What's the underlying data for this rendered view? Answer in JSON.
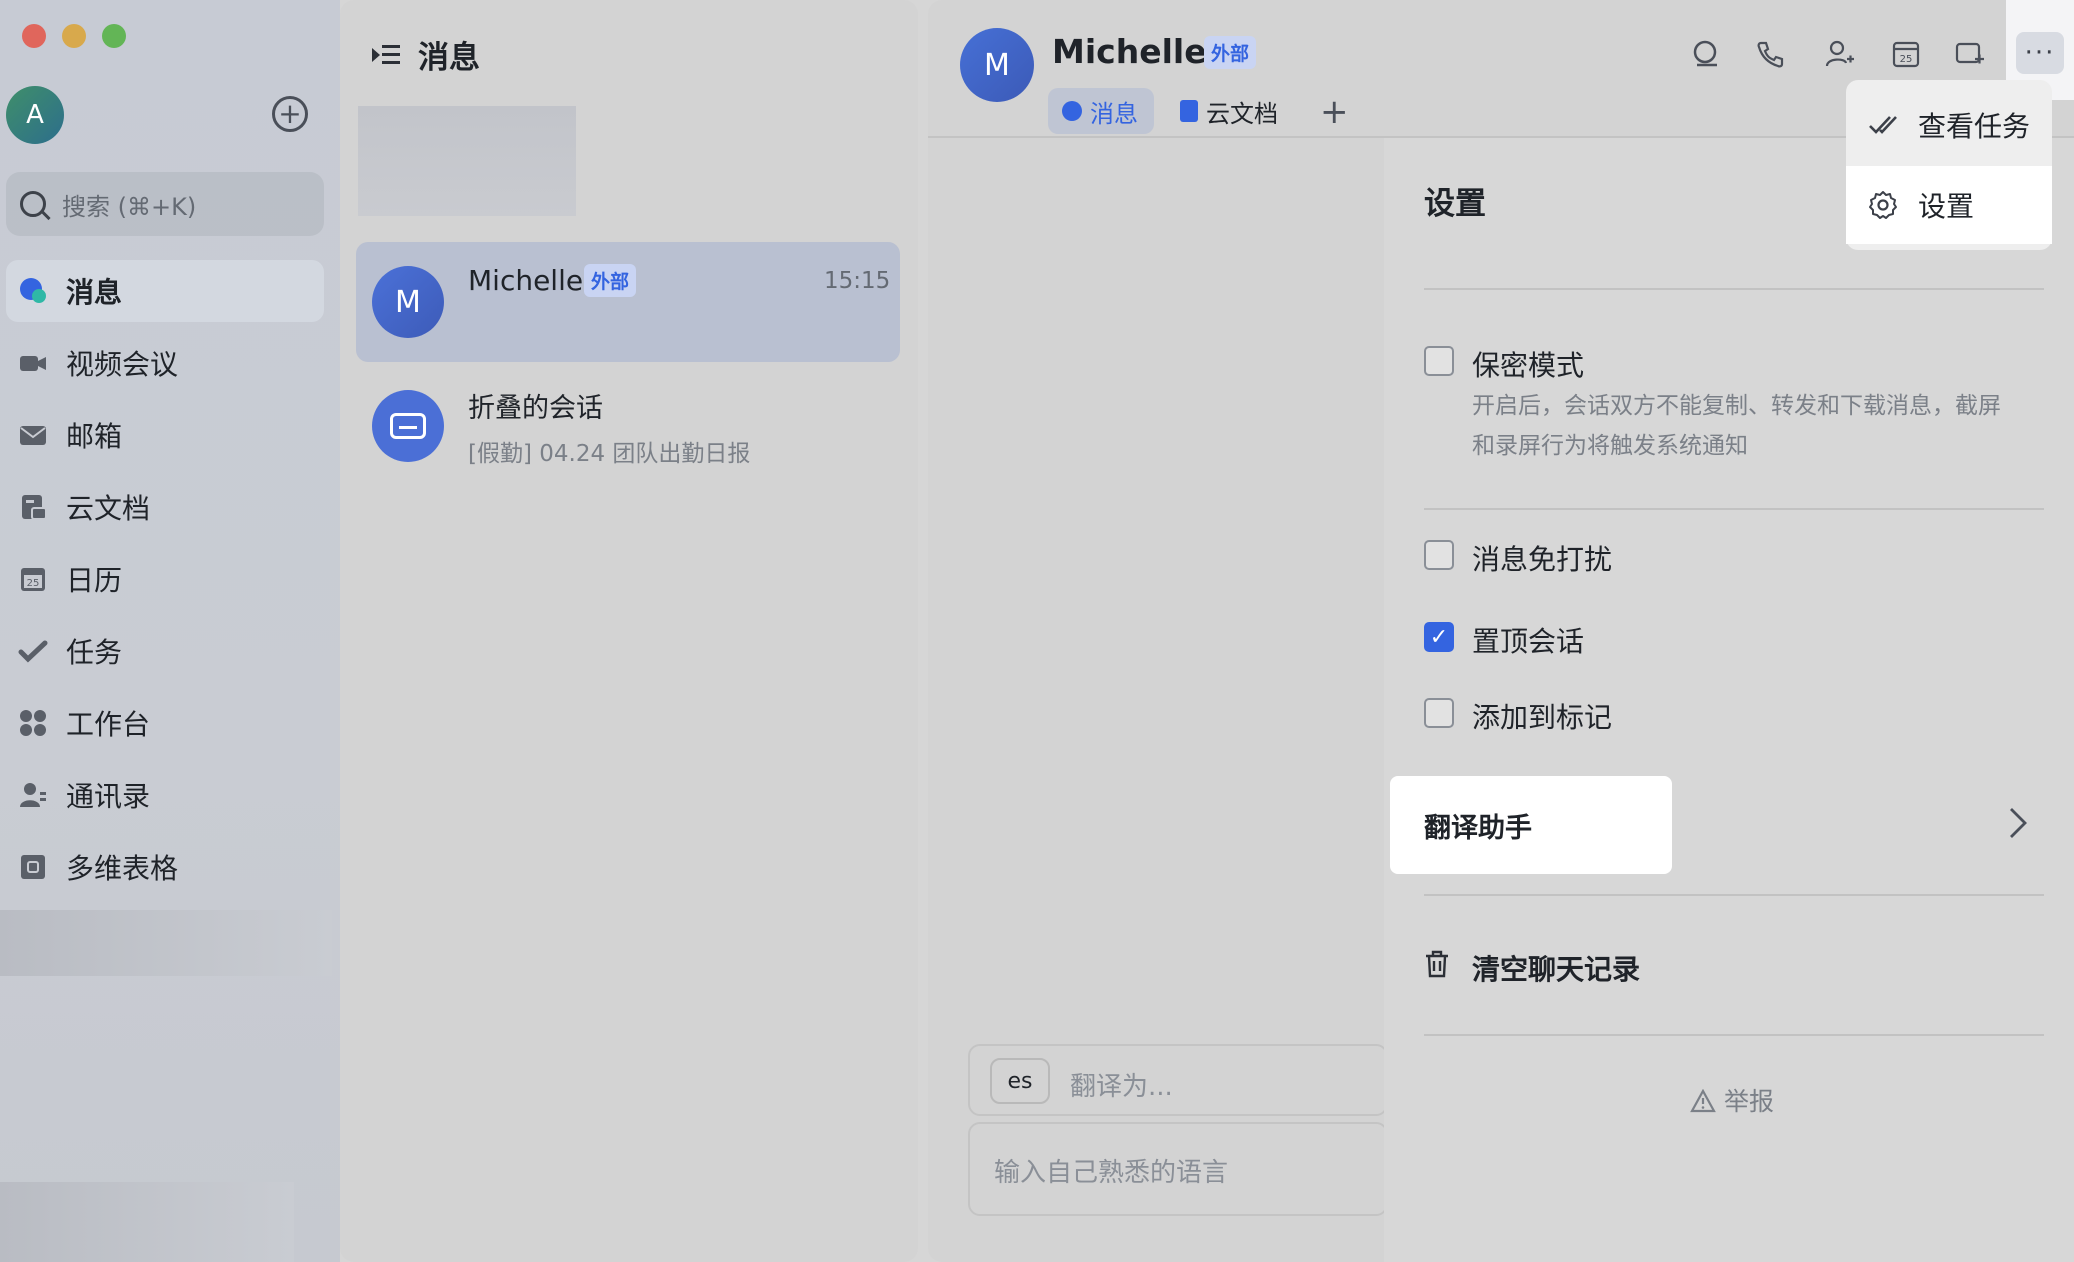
{
  "sidebar": {
    "avatar_letter": "A",
    "search_placeholder": "搜索 (⌘+K)",
    "items": [
      {
        "label": "消息",
        "icon": "chat-bubble-icon"
      },
      {
        "label": "视频会议",
        "icon": "video-camera-icon"
      },
      {
        "label": "邮箱",
        "icon": "mail-icon"
      },
      {
        "label": "云文档",
        "icon": "cloud-doc-icon"
      },
      {
        "label": "日历",
        "icon": "calendar-icon"
      },
      {
        "label": "任务",
        "icon": "task-check-icon"
      },
      {
        "label": "工作台",
        "icon": "workspace-grid-icon"
      },
      {
        "label": "通讯录",
        "icon": "contacts-icon"
      },
      {
        "label": "多维表格",
        "icon": "base-table-icon"
      }
    ]
  },
  "chat_list": {
    "title": "消息",
    "chats": [
      {
        "name": "Michelle",
        "avatar_letter": "M",
        "tag": "外部",
        "time": "15:15"
      },
      {
        "name": "折叠的会话",
        "preview": "[假勤] 04.24 团队出勤日报"
      }
    ]
  },
  "chat": {
    "name": "Michelle",
    "avatar_letter": "M",
    "tag": "外部",
    "tabs": [
      {
        "label": "消息"
      },
      {
        "label": "云文档"
      }
    ],
    "add_tab": "+",
    "lang_chip": "es",
    "translate_placeholder": "翻译为...",
    "input_placeholder": "输入自己熟悉的语言"
  },
  "menu": {
    "items": [
      {
        "label": "查看任务",
        "icon": "double-check-icon"
      },
      {
        "label": "设置",
        "icon": "gear-icon"
      }
    ]
  },
  "settings": {
    "title": "设置",
    "secret_mode": {
      "label": "保密模式",
      "checked": false,
      "desc_line1": "开启后，会话双方不能复制、转发和下载消息，截屏",
      "desc_line2": "和录屏行为将触发系统通知"
    },
    "mute": {
      "label": "消息免打扰",
      "checked": false
    },
    "pin": {
      "label": "置顶会话",
      "checked": true
    },
    "mark": {
      "label": "添加到标记",
      "checked": false
    },
    "translate_assistant": "翻译助手",
    "clear_history": "清空聊天记录",
    "report": "举报"
  },
  "colors": {
    "accent": "#3464e0",
    "traffic_red": "#ec6a5e",
    "traffic_yellow": "#d6a84a",
    "traffic_green": "#61c454"
  }
}
